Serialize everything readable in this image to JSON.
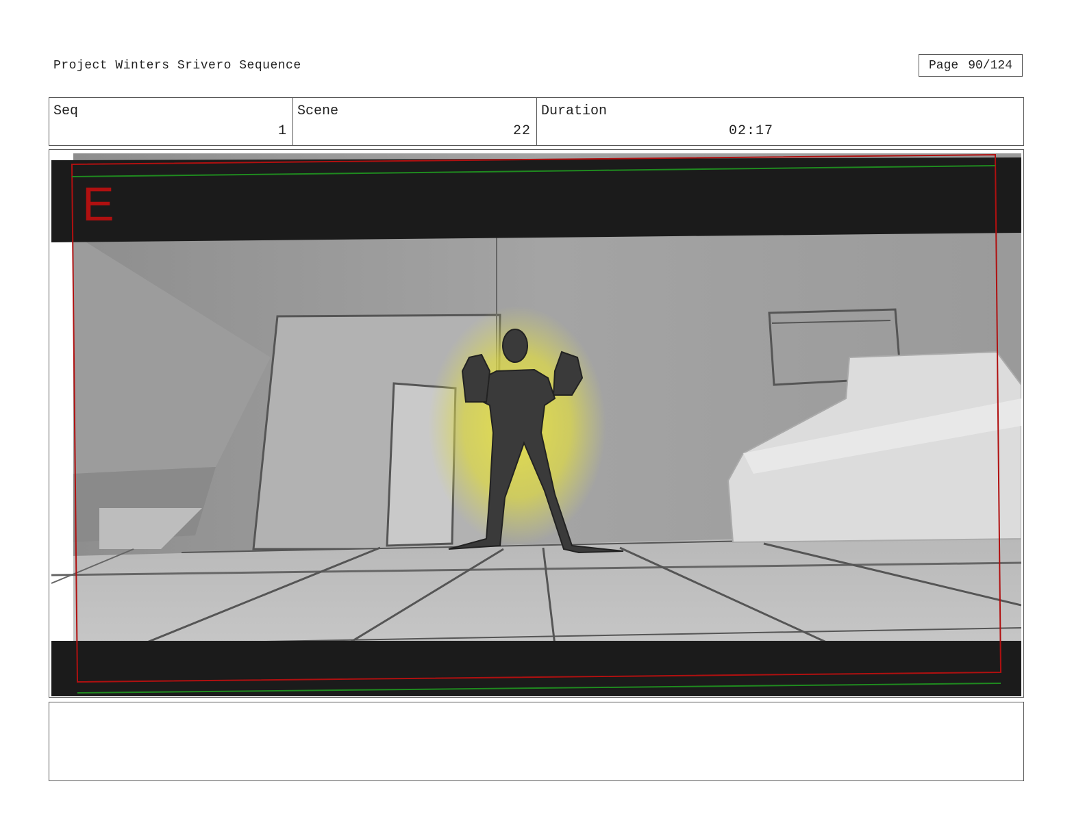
{
  "header": {
    "project_title": "Project Winters Srivero Sequence",
    "page_label": "Page",
    "page_value": "90/124"
  },
  "info": {
    "seq_label": "Seq",
    "seq_value": "1",
    "scene_label": "Scene",
    "scene_value": "22",
    "duration_label": "Duration",
    "duration_value": "02:17"
  },
  "panel": {
    "letter": "E",
    "description_text": ""
  },
  "colors": {
    "letterbox": "#1b1b1b",
    "safe_frame_red": "#b01010",
    "safe_frame_green": "#1f8a1f",
    "glow": "#e8e24a",
    "figure": "#3a3a3a"
  },
  "icons": [
    "hero-figure-sketch"
  ]
}
